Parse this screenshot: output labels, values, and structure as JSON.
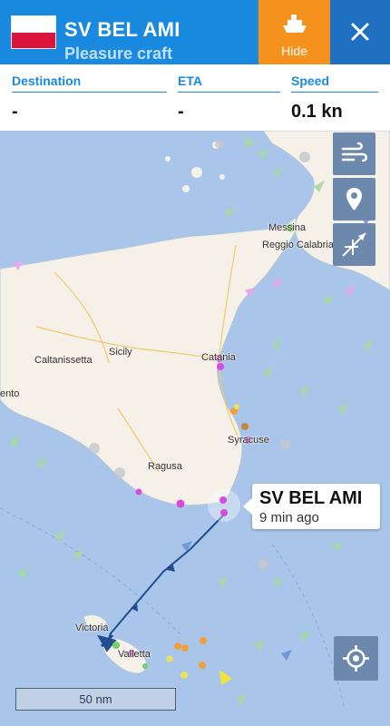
{
  "header": {
    "vessel_name": "SV BEL AMI",
    "vessel_type": "Pleasure craft",
    "flag_colors": [
      "#ffffff",
      "#dc143c"
    ],
    "hide_label": "Hide",
    "hide_icon": "ship-icon",
    "close_icon": "close-icon",
    "colors": {
      "header_bg": "#1a89e0",
      "hide_bg": "#f5921e",
      "close_bg": "#1f70c1"
    }
  },
  "info": {
    "destination_label": "Destination",
    "destination_value": "-",
    "eta_label": "ETA",
    "eta_value": "-",
    "speed_label": "Speed",
    "speed_value": "0.1 kn"
  },
  "map_controls": {
    "buttons": [
      {
        "name": "wind-layer-button",
        "icon": "wind-icon"
      },
      {
        "name": "place-layer-button",
        "icon": "pin-icon"
      },
      {
        "name": "route-layer-button",
        "icon": "route-icon"
      }
    ],
    "locate_icon": "crosshair-icon"
  },
  "callout": {
    "title": "SV BEL AMI",
    "subtitle": "9 min ago"
  },
  "scale": {
    "label": "50 nm"
  },
  "places": {
    "messina": "Messina",
    "reggio": "Reggio Calabria",
    "sicily": "Sicily",
    "caltanissetta": "Caltanissetta",
    "catania": "Catania",
    "ento": "ento",
    "syracuse": "Syracuse",
    "ragusa": "Ragusa",
    "victoria": "Victoria",
    "valletta": "Valletta"
  },
  "colors": {
    "sea": "#a9c6ea",
    "land": "#f5f1e8",
    "track": "#1f4f91"
  }
}
